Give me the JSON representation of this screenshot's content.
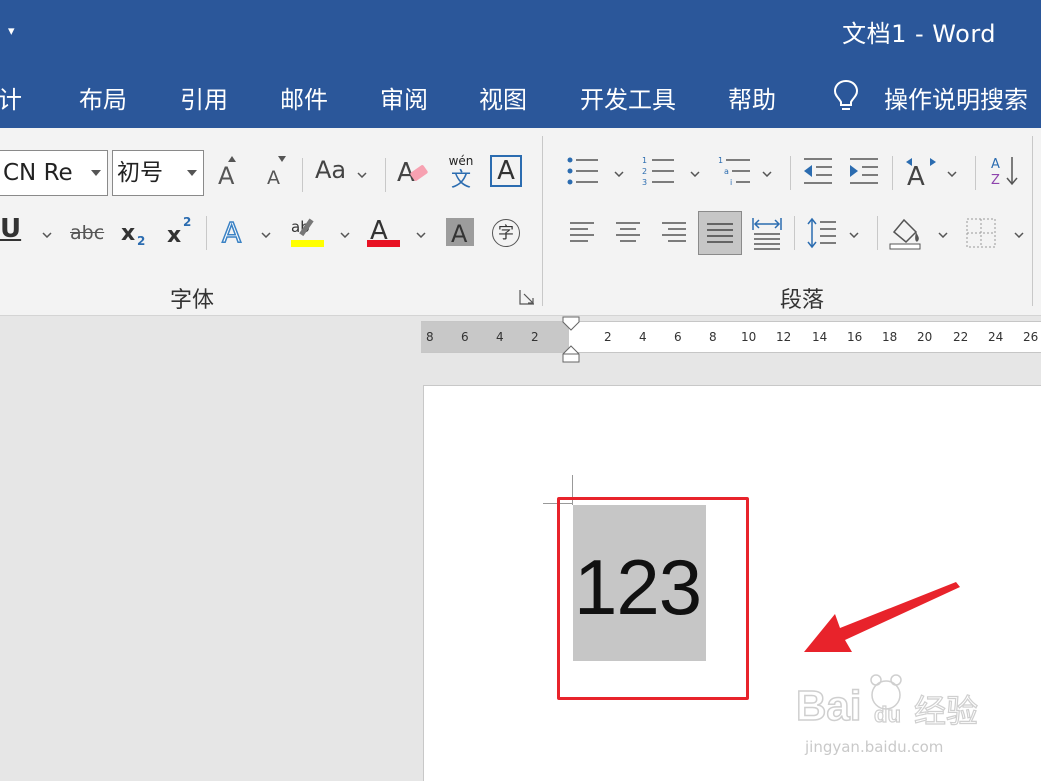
{
  "titlebar": {
    "title": "文档1  -  Word",
    "qa_arrow": "▾"
  },
  "tabs": [
    {
      "id": "design",
      "label": "设计",
      "partial": "计"
    },
    {
      "id": "layout",
      "label": "布局"
    },
    {
      "id": "references",
      "label": "引用"
    },
    {
      "id": "mailings",
      "label": "邮件"
    },
    {
      "id": "review",
      "label": "审阅"
    },
    {
      "id": "view",
      "label": "视图"
    },
    {
      "id": "developer",
      "label": "开发工具"
    },
    {
      "id": "help",
      "label": "帮助"
    },
    {
      "id": "tell_me",
      "label": "操作说明搜索"
    }
  ],
  "font_group": {
    "label": "字体",
    "font_name": "CN Re",
    "font_size": "初号",
    "change_case": "Aa",
    "phonetic_top": "wén",
    "phonetic_bottom": "文",
    "border_char": "A",
    "strike": "abc",
    "underline": "U",
    "enclose": "字",
    "highlight_color": "#ffff00",
    "font_color": "#e81123"
  },
  "paragraph_group": {
    "label": "段落"
  },
  "ruler": {
    "ticks": [
      "8",
      "6",
      "4",
      "2",
      "2",
      "4",
      "6",
      "8",
      "10",
      "12",
      "14",
      "16",
      "18",
      "20",
      "22",
      "24",
      "26"
    ]
  },
  "document": {
    "selected_text": "123"
  },
  "watermark": {
    "brand": "Bai du 经验",
    "url": "jingyan.baidu.com"
  },
  "colors": {
    "word_blue": "#2b579a",
    "red_annotation": "#e8232b"
  }
}
